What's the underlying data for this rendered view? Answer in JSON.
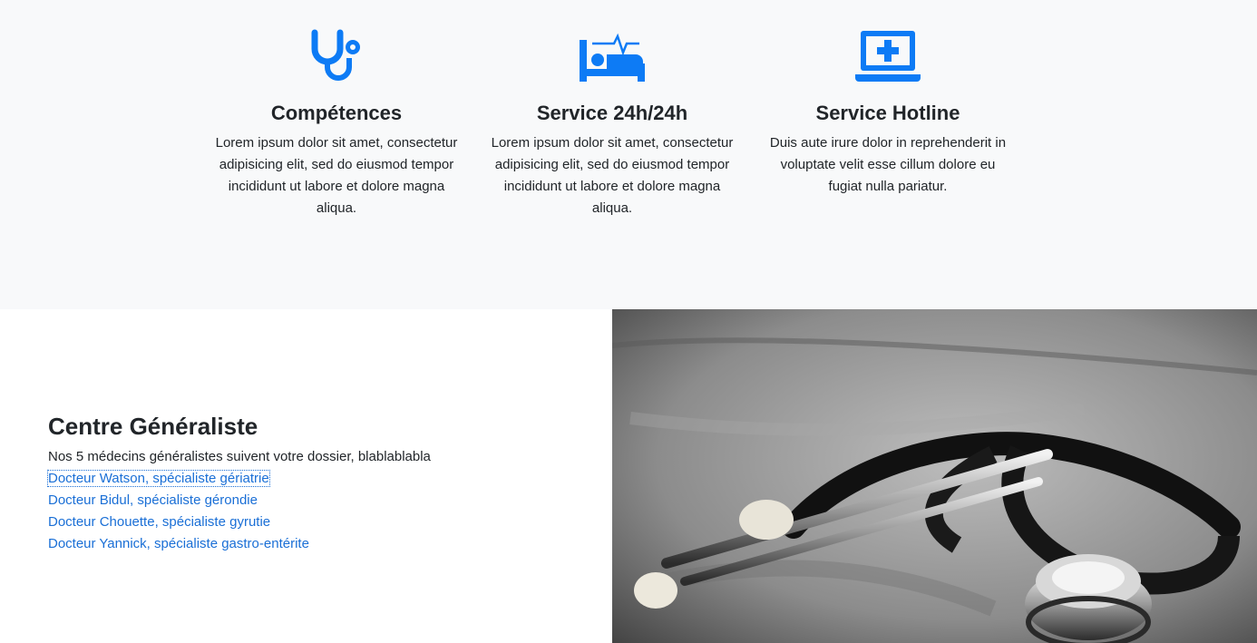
{
  "features": [
    {
      "icon": "stethoscope-icon",
      "title": "Compétences",
      "text": "Lorem ipsum dolor sit amet, consectetur adipisicing elit, sed do eiusmod tempor incididunt ut labore et dolore magna aliqua."
    },
    {
      "icon": "hospital-bed-icon",
      "title": "Service 24h/24h",
      "text": "Lorem ipsum dolor sit amet, consectetur adipisicing elit, sed do eiusmod tempor incididunt ut labore et dolore magna aliqua."
    },
    {
      "icon": "laptop-medical-icon",
      "title": "Service Hotline",
      "text": "Duis aute irure dolor in reprehenderit in voluptate velit esse cillum dolore eu fugiat nulla pariatur."
    }
  ],
  "centre": {
    "title": "Centre Généraliste",
    "lead": "Nos 5 médecins généralistes suivent votre dossier, blablablabla",
    "doctors": [
      "Docteur Watson, spécialiste gériatrie",
      "Docteur Bidul, spécialiste gérondie",
      "Docteur Chouette, spécialiste gyrutie",
      "Docteur Yannick, spécialiste gastro-entérite"
    ]
  },
  "image": {
    "subject": "stethoscope-photo"
  },
  "colors": {
    "accent": "#0d7bf5",
    "link": "#1a6fd6",
    "section_bg": "#f8f9fa",
    "text": "#212529"
  }
}
